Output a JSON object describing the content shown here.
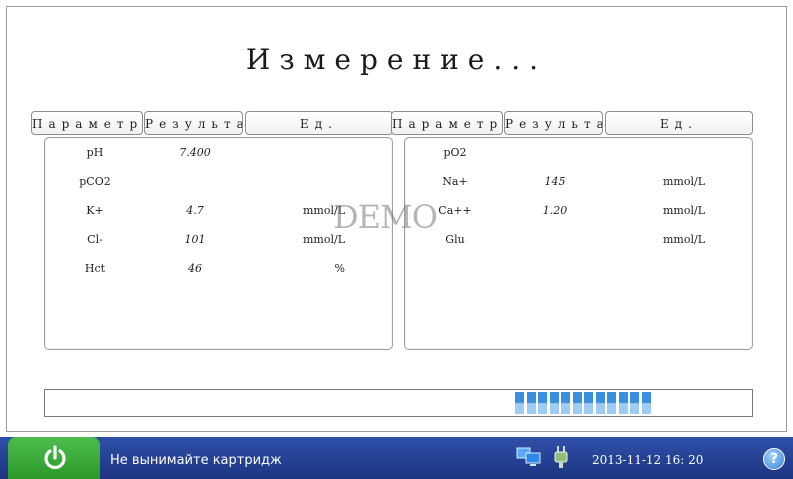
{
  "screen": {
    "title": "Измерение..."
  },
  "left_table": {
    "headers": [
      "Параметр",
      "Результат",
      "Ед."
    ],
    "rows": [
      {
        "name": "pH",
        "value": "7.400",
        "unit": ""
      },
      {
        "name": "pCO2",
        "value": "",
        "unit": ""
      },
      {
        "name": "K+",
        "value": "4.7",
        "unit": "mmol/L"
      },
      {
        "name": "Cl-",
        "value": "101",
        "unit": "mmol/L"
      },
      {
        "name": "Hct",
        "value": "46",
        "unit": "%"
      }
    ]
  },
  "right_table": {
    "headers": [
      "Параметр",
      "Результат",
      "Ед."
    ],
    "rows": [
      {
        "name": "pO2",
        "value": "",
        "unit": ""
      },
      {
        "name": "Na+",
        "value": "145",
        "unit": "mmol/L"
      },
      {
        "name": "Ca++",
        "value": "1.20",
        "unit": "mmol/L"
      },
      {
        "name": "Glu",
        "value": "",
        "unit": "mmol/L"
      }
    ]
  },
  "watermark": "DEMO",
  "progress": {
    "segments_filled": 12,
    "fraction": 0.61
  },
  "taskbar": {
    "status_text": "Не вынимайте картридж",
    "datetime": "2013-11-12  16: 20",
    "power_icon": "power-icon",
    "network_icon": "network-icon",
    "plug_icon": "power-plug-icon",
    "help_icon": "help-icon",
    "help_glyph": "?"
  },
  "colors": {
    "taskbar": "#1d3582",
    "power_button": "#2b9a2b",
    "progress_segment": "#3a8ee0"
  }
}
